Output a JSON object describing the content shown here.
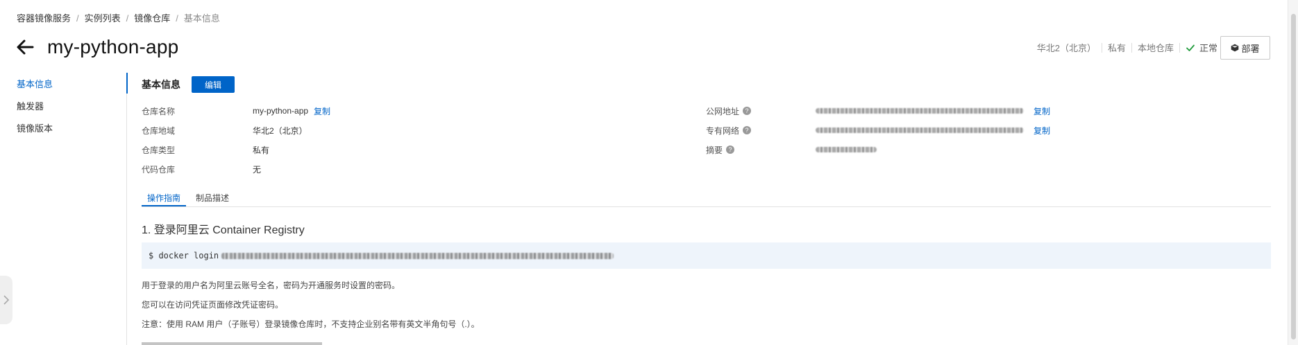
{
  "breadcrumb": {
    "items": [
      "容器镜像服务",
      "实例列表",
      "镜像仓库",
      "基本信息"
    ],
    "separator": "/"
  },
  "header": {
    "title": "my-python-app",
    "region": "华北2（北京）",
    "visibility": "私有",
    "repo_type": "本地仓库",
    "status": "正常",
    "deploy_label": "部署"
  },
  "sidebar": {
    "items": [
      {
        "label": "基本信息",
        "active": true
      },
      {
        "label": "触发器",
        "active": false
      },
      {
        "label": "镜像版本",
        "active": false
      }
    ]
  },
  "basic_info": {
    "title": "基本信息",
    "edit_label": "编辑",
    "copy_label": "复制",
    "left": [
      {
        "label": "仓库名称",
        "value": "my-python-app"
      },
      {
        "label": "仓库地域",
        "value": "华北2（北京）"
      },
      {
        "label": "仓库类型",
        "value": "私有"
      },
      {
        "label": "代码仓库",
        "value": "无"
      }
    ],
    "right": [
      {
        "label": "公网地址"
      },
      {
        "label": "专有网络"
      },
      {
        "label": "摘要"
      }
    ]
  },
  "tabs": [
    {
      "label": "操作指南",
      "active": true
    },
    {
      "label": "制品描述",
      "active": false
    }
  ],
  "guide": {
    "step1_title": "1. 登录阿里云 Container Registry",
    "command_prefix": "$ docker login",
    "note1": "用于登录的用户名为阿里云账号全名，密码为开通服务时设置的密码。",
    "note2": "您可以在访问凭证页面修改凭证密码。",
    "note3": "注意：使用 RAM 用户（子账号）登录镜像仓库时，不支持企业别名带有英文半角句号（.）。"
  },
  "colors": {
    "accent": "#0064c8",
    "status_ok": "#1e9b3a",
    "code_bg": "#eef4fb"
  },
  "icons": [
    "arrow-left-icon",
    "check-icon",
    "cube-icon",
    "question-circle-icon",
    "chevron-right-icon"
  ]
}
